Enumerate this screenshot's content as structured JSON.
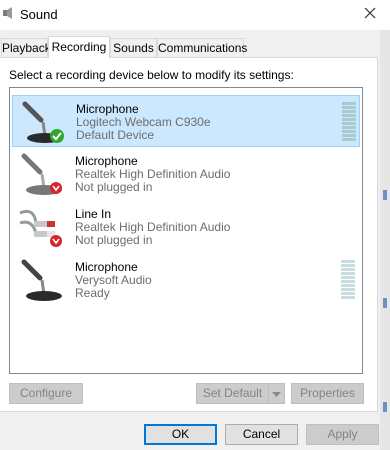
{
  "window": {
    "title": "Sound",
    "icon": "speaker-icon",
    "close_icon": "close-icon"
  },
  "tabs": [
    {
      "label": "Playback",
      "active": false
    },
    {
      "label": "Recording",
      "active": true
    },
    {
      "label": "Sounds",
      "active": false
    },
    {
      "label": "Communications",
      "active": false
    }
  ],
  "instructions": "Select a recording device below to modify its settings:",
  "devices": [
    {
      "name": "Microphone",
      "driver": "Logitech Webcam C930e",
      "status": "Default Device",
      "icon": "microphone-icon",
      "badge": "default-check-icon",
      "selected": true,
      "level_meter": true
    },
    {
      "name": "Microphone",
      "driver": "Realtek High Definition Audio",
      "status": "Not plugged in",
      "icon": "microphone-icon",
      "badge": "unplugged-arrow-icon",
      "selected": false,
      "level_meter": false
    },
    {
      "name": "Line In",
      "driver": "Realtek High Definition Audio",
      "status": "Not plugged in",
      "icon": "line-in-cable-icon",
      "badge": "unplugged-arrow-icon",
      "selected": false,
      "level_meter": false
    },
    {
      "name": "Microphone",
      "driver": "Verysoft Audio",
      "status": "Ready",
      "icon": "microphone-icon",
      "badge": null,
      "selected": false,
      "level_meter": true
    }
  ],
  "buttons": {
    "configure": "Configure",
    "set_default": "Set Default",
    "properties": "Properties",
    "ok": "OK",
    "cancel": "Cancel",
    "apply": "Apply"
  },
  "colors": {
    "selection": "#cce8ff",
    "selection_border": "#99d1ff",
    "default_check": "#2fa82f",
    "unplugged_badge": "#d4262c",
    "focus_blue": "#0078d7"
  }
}
